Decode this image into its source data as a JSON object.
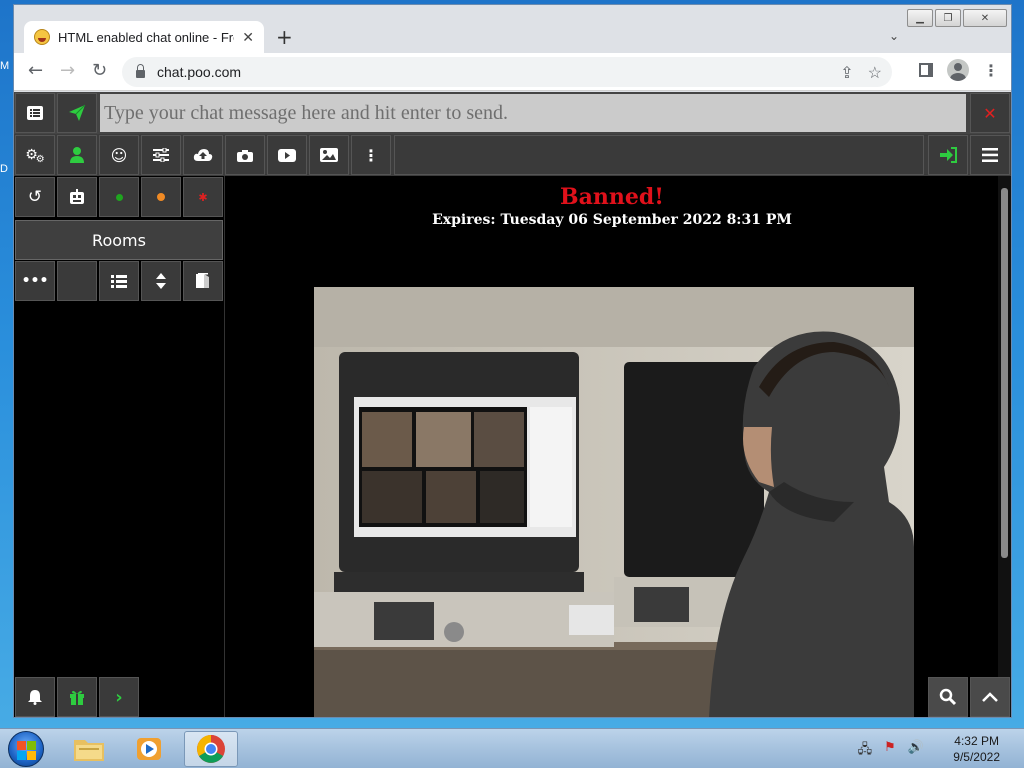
{
  "desktop": {
    "edge_letters": [
      "M",
      "D"
    ]
  },
  "browser": {
    "tab_title": "HTML enabled chat online - Free",
    "tab_close": "✕",
    "new_tab": "+",
    "url": "chat.poo.com",
    "window_controls": [
      "minimize",
      "restore",
      "close"
    ]
  },
  "chat": {
    "message_placeholder": "Type your chat message here and hit enter to send.",
    "rooms_label": "Rooms",
    "status_dots": [
      {
        "name": "green-status-dot",
        "color": "#1fa51f"
      },
      {
        "name": "orange-status-dot",
        "color": "#f08a24"
      },
      {
        "name": "red-status-dot",
        "color": "#e02020"
      }
    ],
    "accent_green": "#2ecc40",
    "close_red": "#e02020",
    "ban_title": "Banned!",
    "ban_expires": "Expires: Tuesday 06 September 2022 8:31 PM"
  },
  "taskbar": {
    "time": "4:32 PM",
    "date": "9/5/2022"
  }
}
